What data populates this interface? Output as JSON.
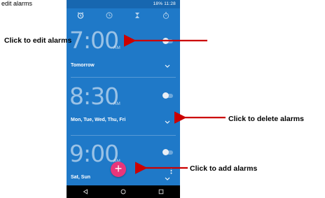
{
  "top_cut_label": "edit alarms",
  "status_bar": {
    "text": "18%  11:28"
  },
  "tabs": [
    {
      "icon": "alarm-clock-icon"
    },
    {
      "icon": "clock-icon"
    },
    {
      "icon": "hourglass-icon"
    },
    {
      "icon": "stopwatch-icon"
    }
  ],
  "alarms": [
    {
      "time": "7:00",
      "ampm": "AM",
      "days": "Tomorrow"
    },
    {
      "time": "8:30",
      "ampm": "AM",
      "days": "Mon, Tue, Wed, Thu, Fri"
    },
    {
      "time": "9:00",
      "ampm": "AM",
      "days": "Sat, Sun"
    }
  ],
  "fab": {
    "label": "+"
  },
  "annotations": {
    "edit": "Click to edit alarms",
    "delete": "Click to delete alarms",
    "add": "Click to add alarms"
  },
  "colors": {
    "background": "#1f79c8",
    "status_bar": "#1767b0",
    "fab": "#e9357a",
    "arrow": "#cc0000",
    "navbar": "#000000"
  },
  "navbar": [
    {
      "icon": "back-icon"
    },
    {
      "icon": "home-icon"
    },
    {
      "icon": "recents-icon"
    }
  ]
}
